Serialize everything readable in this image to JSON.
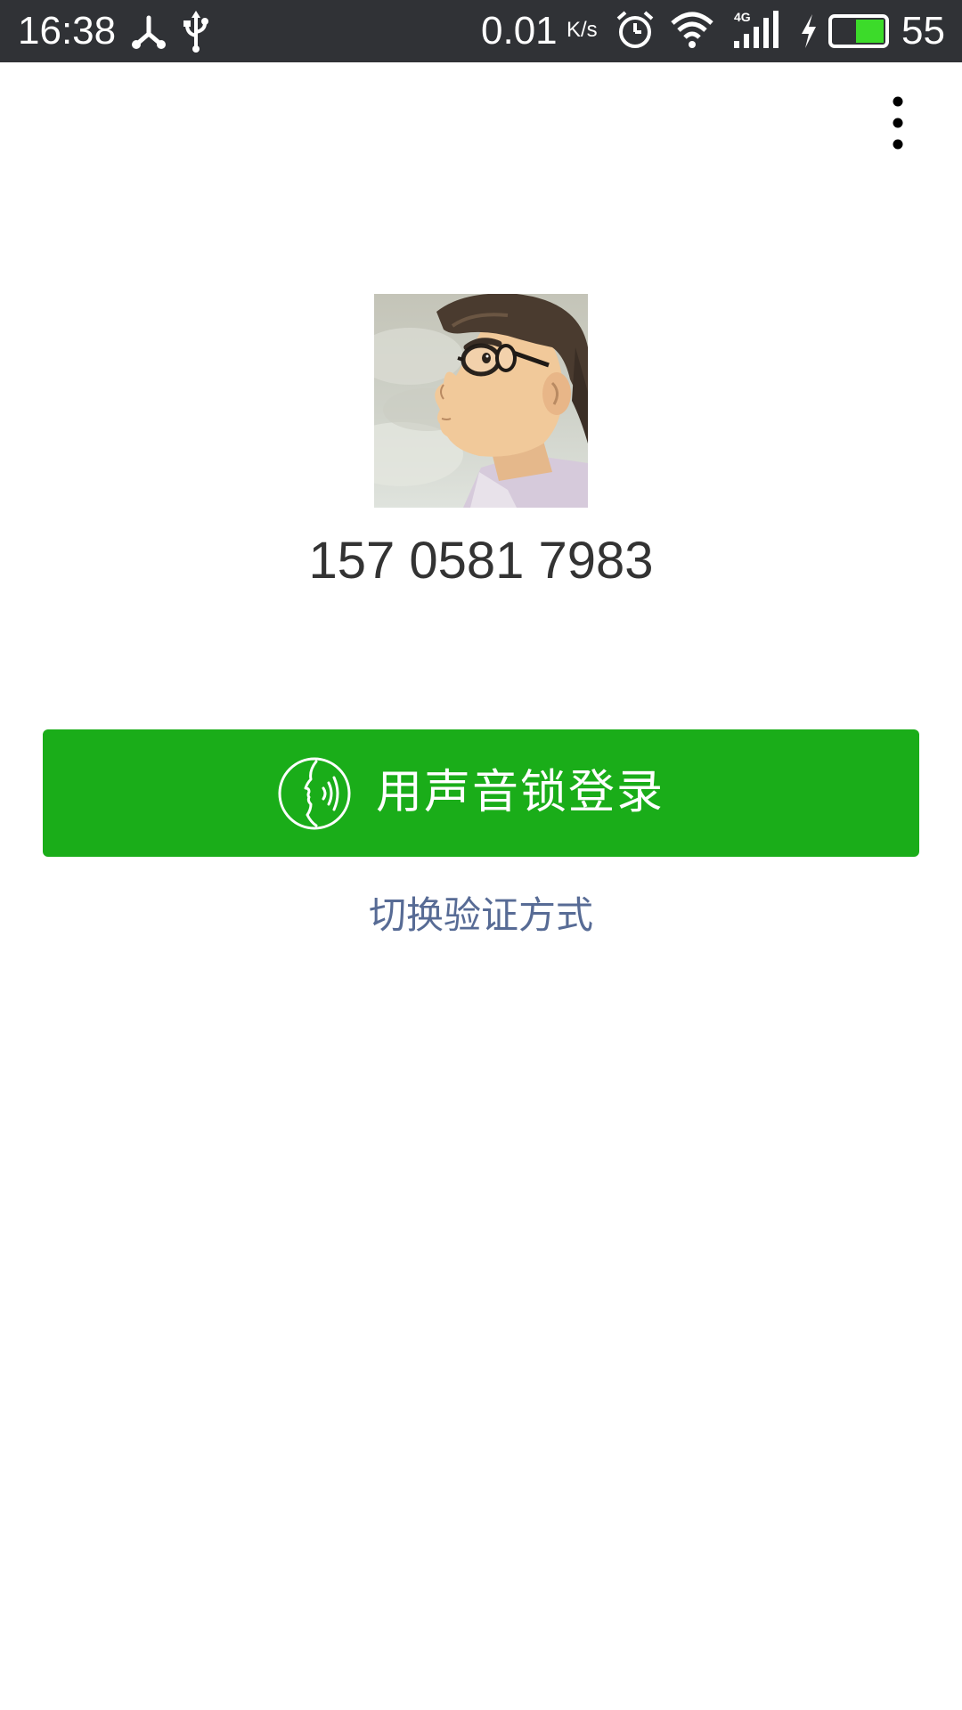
{
  "status_bar": {
    "time": "16:38",
    "network_speed": "0.01",
    "network_speed_unit": "K/s",
    "network_type": "4G",
    "battery_percent": "55",
    "battery_level": 0.55,
    "icons": [
      "network-share-icon",
      "usb-icon",
      "alarm-icon",
      "wifi-icon",
      "cellular-signal-icon",
      "charging-icon",
      "battery-icon"
    ]
  },
  "header": {
    "menu_icon": "more-vertical-icon"
  },
  "profile": {
    "phone_number": "157 0581 7983"
  },
  "actions": {
    "login_button_label": "用声音锁登录",
    "login_button_icon": "voice-lock-icon",
    "switch_link_label": "切换验证方式"
  },
  "colors": {
    "primary_green": "#1aad19",
    "link_blue": "#576b95",
    "status_bar_bg": "#303236",
    "phone_text": "#333333"
  }
}
